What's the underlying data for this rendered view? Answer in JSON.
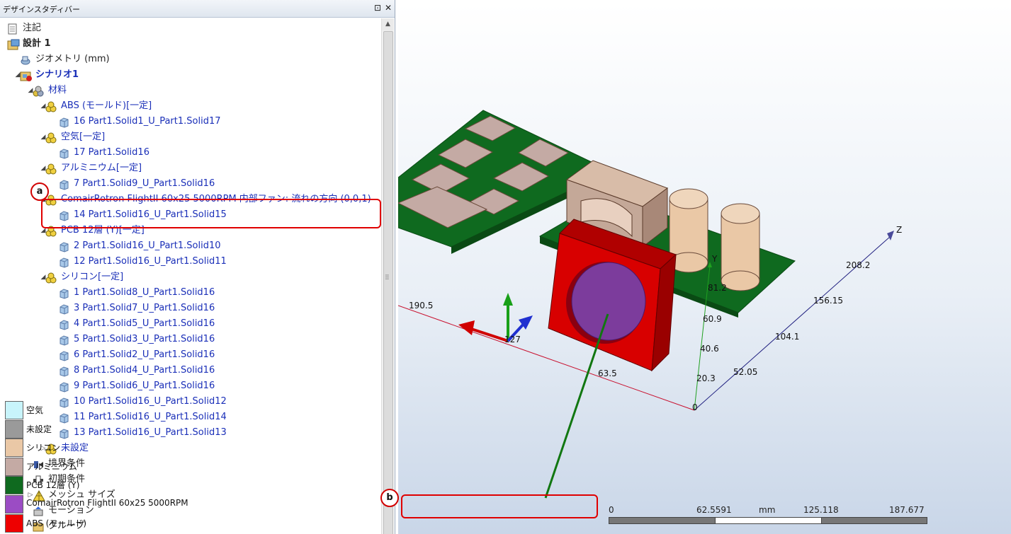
{
  "panel": {
    "title": "デザインスタディバー",
    "pin_icon": "pin-icon",
    "close_icon": "close-icon"
  },
  "tree": [
    {
      "label": "注記",
      "icon": "notes-icon",
      "level": 0,
      "expander": "",
      "style": "dark"
    },
    {
      "label": "設計 1",
      "icon": "design-icon",
      "level": 0,
      "expander": "",
      "style": "dark bold"
    },
    {
      "label": "ジオメトリ (mm)",
      "icon": "geometry-icon",
      "level": 1,
      "expander": "",
      "style": "dark"
    },
    {
      "label": "シナリオ1",
      "icon": "scenario-icon",
      "level": 1,
      "expander": "◢",
      "style": "bold"
    },
    {
      "label": "材料",
      "icon": "materials-icon",
      "level": 2,
      "expander": "◢",
      "style": ""
    },
    {
      "label": "ABS (モールド)[一定]",
      "icon": "material-icon",
      "level": 3,
      "expander": "◢",
      "style": ""
    },
    {
      "label": "16 Part1.Solid1_U_Part1.Solid17",
      "icon": "solid-icon",
      "level": 4,
      "expander": "",
      "style": ""
    },
    {
      "label": "空気[一定]",
      "icon": "material-icon",
      "level": 3,
      "expander": "◢",
      "style": ""
    },
    {
      "label": "17 Part1.Solid16",
      "icon": "solid-icon",
      "level": 4,
      "expander": "",
      "style": ""
    },
    {
      "label": "アルミニウム[一定]",
      "icon": "material-icon",
      "level": 3,
      "expander": "◢",
      "style": ""
    },
    {
      "label": "7 Part1.Solid9_U_Part1.Solid16",
      "icon": "solid-icon",
      "level": 4,
      "expander": "",
      "style": ""
    },
    {
      "label": "ComairRotron FlightII 60x25 5000RPM 内部ファン: 流れの方向 (0,0,1)",
      "icon": "material-icon",
      "level": 3,
      "expander": "◢",
      "style": ""
    },
    {
      "label": "14 Part1.Solid16_U_Part1.Solid15",
      "icon": "solid-icon",
      "level": 4,
      "expander": "",
      "style": ""
    },
    {
      "label": "PCB 12層 (Y)[一定]",
      "icon": "material-icon",
      "level": 3,
      "expander": "◢",
      "style": ""
    },
    {
      "label": "2 Part1.Solid16_U_Part1.Solid10",
      "icon": "solid-icon",
      "level": 4,
      "expander": "",
      "style": ""
    },
    {
      "label": "12 Part1.Solid16_U_Part1.Solid11",
      "icon": "solid-icon",
      "level": 4,
      "expander": "",
      "style": ""
    },
    {
      "label": "シリコン[一定]",
      "icon": "material-icon",
      "level": 3,
      "expander": "◢",
      "style": ""
    },
    {
      "label": "1 Part1.Solid8_U_Part1.Solid16",
      "icon": "solid-icon",
      "level": 4,
      "expander": "",
      "style": ""
    },
    {
      "label": "3 Part1.Solid7_U_Part1.Solid16",
      "icon": "solid-icon",
      "level": 4,
      "expander": "",
      "style": ""
    },
    {
      "label": "4 Part1.Solid5_U_Part1.Solid16",
      "icon": "solid-icon",
      "level": 4,
      "expander": "",
      "style": ""
    },
    {
      "label": "5 Part1.Solid3_U_Part1.Solid16",
      "icon": "solid-icon",
      "level": 4,
      "expander": "",
      "style": ""
    },
    {
      "label": "6 Part1.Solid2_U_Part1.Solid16",
      "icon": "solid-icon",
      "level": 4,
      "expander": "",
      "style": ""
    },
    {
      "label": "8 Part1.Solid4_U_Part1.Solid16",
      "icon": "solid-icon",
      "level": 4,
      "expander": "",
      "style": ""
    },
    {
      "label": "9 Part1.Solid6_U_Part1.Solid16",
      "icon": "solid-icon",
      "level": 4,
      "expander": "",
      "style": ""
    },
    {
      "label": "10 Part1.Solid16_U_Part1.Solid12",
      "icon": "solid-icon",
      "level": 4,
      "expander": "",
      "style": ""
    },
    {
      "label": "11 Part1.Solid16_U_Part1.Solid14",
      "icon": "solid-icon",
      "level": 4,
      "expander": "",
      "style": ""
    },
    {
      "label": "13 Part1.Solid16_U_Part1.Solid13",
      "icon": "solid-icon",
      "level": 4,
      "expander": "",
      "style": ""
    },
    {
      "label": "未設定",
      "icon": "material-icon",
      "level": 3,
      "expander": "▷",
      "style": ""
    },
    {
      "label": "境界条件",
      "icon": "boundary-icon",
      "level": 2,
      "expander": "",
      "style": "dark"
    },
    {
      "label": "初期条件",
      "icon": "initial-icon",
      "level": 2,
      "expander": "",
      "style": "dark"
    },
    {
      "label": "メッシュ サイズ",
      "icon": "mesh-icon",
      "level": 2,
      "expander": "▷",
      "style": "dark"
    },
    {
      "label": "モーション",
      "icon": "motion-icon",
      "level": 2,
      "expander": "",
      "style": "dark"
    },
    {
      "label": "グループ",
      "icon": "group-icon",
      "level": 2,
      "expander": "",
      "style": "dark"
    }
  ],
  "callouts": {
    "a": "a",
    "b": "b"
  },
  "legend": [
    {
      "label": "空気",
      "color": "#c8f4fb"
    },
    {
      "label": "未設定",
      "color": "#9a9a9a"
    },
    {
      "label": "シリコン",
      "color": "#eac8a6"
    },
    {
      "label": "アルミニウム",
      "color": "#c4aaa4"
    },
    {
      "label": "PCB 12層 (Y)",
      "color": "#0f6a1f"
    },
    {
      "label": "ComairRotron FlightII 60x25 5000RPM",
      "color": "#9b4cc4"
    },
    {
      "label": "ABS (モールド)",
      "color": "#ee0000"
    }
  ],
  "axes": {
    "x_tick_190": "190.5",
    "x_tick_127": "127",
    "x_tick_63": "63.5",
    "x_origin": "0",
    "y_label": "Y",
    "y_tick_81": "81.2",
    "y_tick_60": "60.9",
    "y_tick_40": "40.6",
    "y_tick_20": "20.3",
    "z_label": "Z",
    "z_tick_208": "208.2",
    "z_tick_156": "156.15",
    "z_tick_104": "104.1",
    "z_tick_52": "52.05"
  },
  "scale": {
    "t0": "0",
    "t1": "62.5591",
    "unit": "mm",
    "t2": "125.118",
    "t3": "187.677"
  },
  "colors": {
    "pcb": "#0f6a1f",
    "chip": "#c4aaa4",
    "silicon": "#eac8a6",
    "fan_body": "#d80000",
    "fan_disc": "#7c3c9c",
    "highlight": "#e00000"
  }
}
